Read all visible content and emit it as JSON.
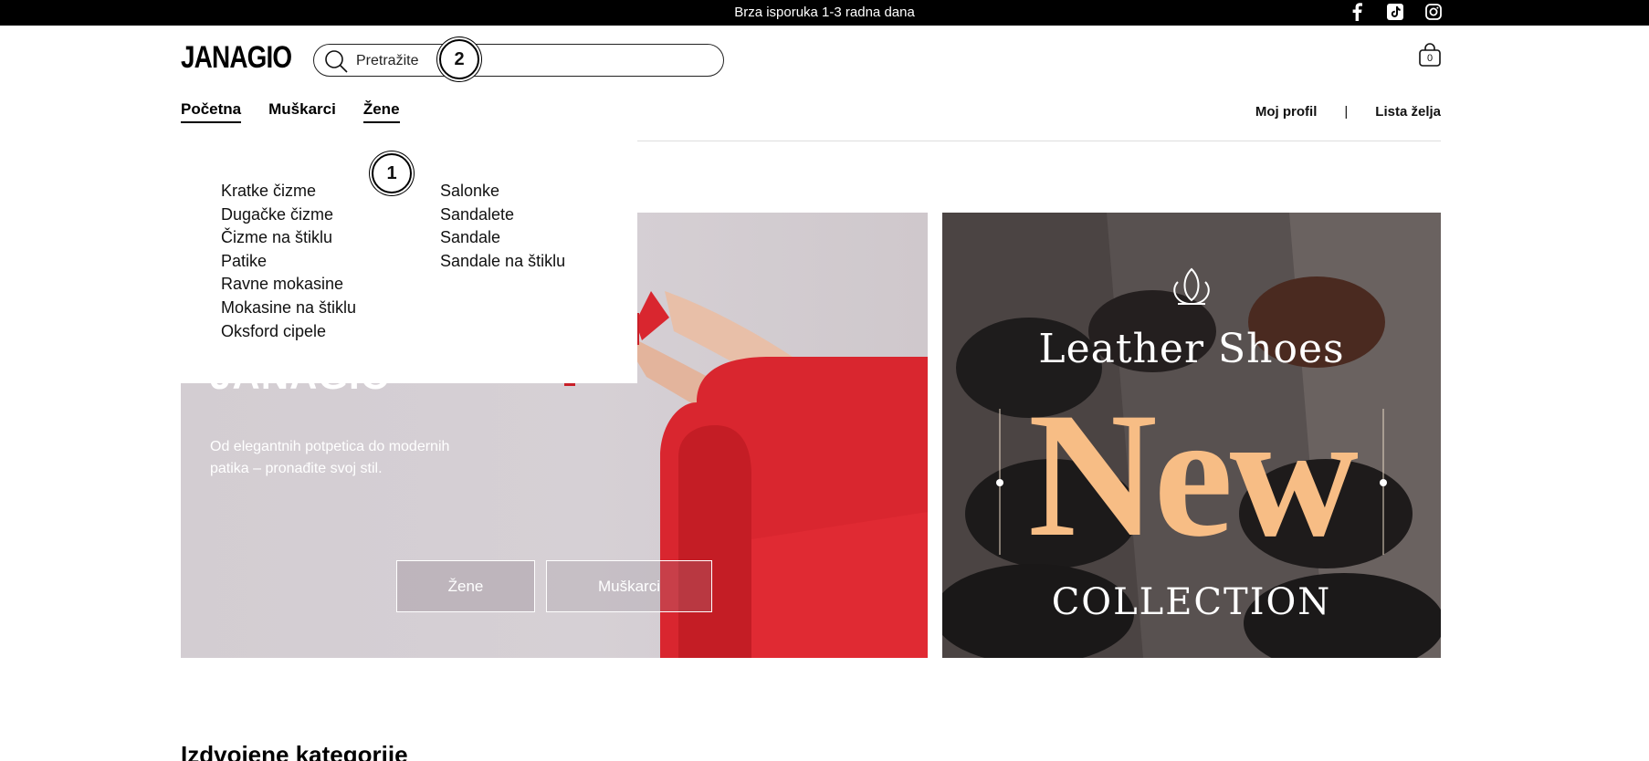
{
  "topbar": {
    "message": "Brza isporuka 1-3 radna dana",
    "socials": [
      "facebook-icon",
      "tiktok-icon",
      "instagram-icon"
    ]
  },
  "header": {
    "logo": "JANAGIO",
    "search": {
      "placeholder": "Pretražite"
    },
    "cart": {
      "count": "0"
    }
  },
  "nav": {
    "items": [
      {
        "label": "Početna",
        "active": true
      },
      {
        "label": "Muškarci",
        "active": false
      },
      {
        "label": "Žene",
        "active": true
      }
    ],
    "account": {
      "profile": "Moj profil",
      "separator": "|",
      "wishlist": "Lista želja"
    }
  },
  "dropdown": {
    "column1": [
      "Kratke čizme",
      "Dugačke čizme",
      "Čizme na štiklu",
      "Patike",
      "Ravne mokasine",
      "Mokasine na štiklu",
      "Oksford cipele"
    ],
    "column2": [
      "Salonke",
      "Sandalete",
      "Sandale",
      "Sandale na štiklu"
    ]
  },
  "hero": {
    "title": "JANAGIO",
    "subtitle": "Od elegantnih potpetica do modernih patika – pronađite svoj stil.",
    "buttons": {
      "women": "Žene",
      "men": "Muškarci"
    }
  },
  "promo": {
    "line1": "Leather Shoes",
    "line2": "New",
    "line3": "COLLECTION"
  },
  "markers": {
    "one": "1",
    "two": "2"
  },
  "sections": {
    "featured": "Izdvojene kategorije"
  },
  "colors": {
    "accent_peach": "#f7bd85",
    "sofa_red": "#d9262f"
  }
}
